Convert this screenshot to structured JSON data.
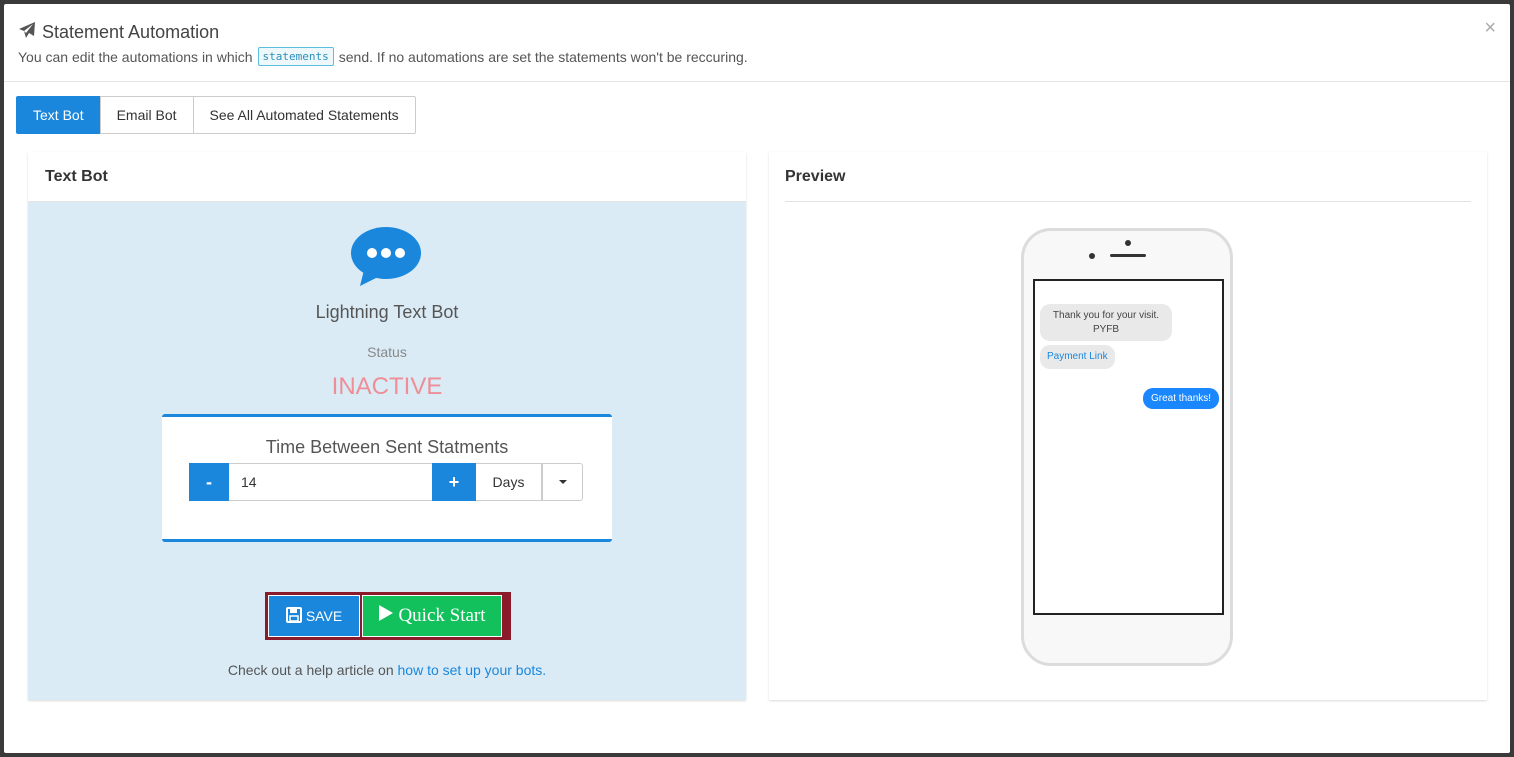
{
  "header": {
    "title": "Statement Automation",
    "subtitle_before": "You can edit the automations in which",
    "code_word": "statements",
    "subtitle_after": "send. If no automations are set the statements won't be reccuring.",
    "close_label": "×"
  },
  "tabs": [
    {
      "label": "Text Bot",
      "active": true
    },
    {
      "label": "Email Bot",
      "active": false
    },
    {
      "label": "See All Automated Statements",
      "active": false
    }
  ],
  "bot_panel": {
    "heading": "Text Bot",
    "bot_name": "Lightning Text Bot",
    "status_label": "Status",
    "status_value": "INACTIVE",
    "interval": {
      "title": "Time Between Sent Statments",
      "minus_label": "-",
      "value": "14",
      "plus_label": "+",
      "unit": "Days"
    },
    "save_label": "SAVE",
    "quick_start_label": "Quick Start",
    "help_text": "Check out a help article on",
    "help_link": "how to set up your bots."
  },
  "preview_panel": {
    "heading": "Preview",
    "messages": {
      "incoming_line1": "Thank you for your visit.",
      "incoming_line2": "PYFB",
      "link_text": "Payment Link",
      "outgoing": "Great thanks!"
    }
  },
  "colors": {
    "primary": "#1a87dd",
    "success": "#13c15c",
    "inactive": "#ef8e97",
    "highlight_border": "#8b1a2b"
  }
}
